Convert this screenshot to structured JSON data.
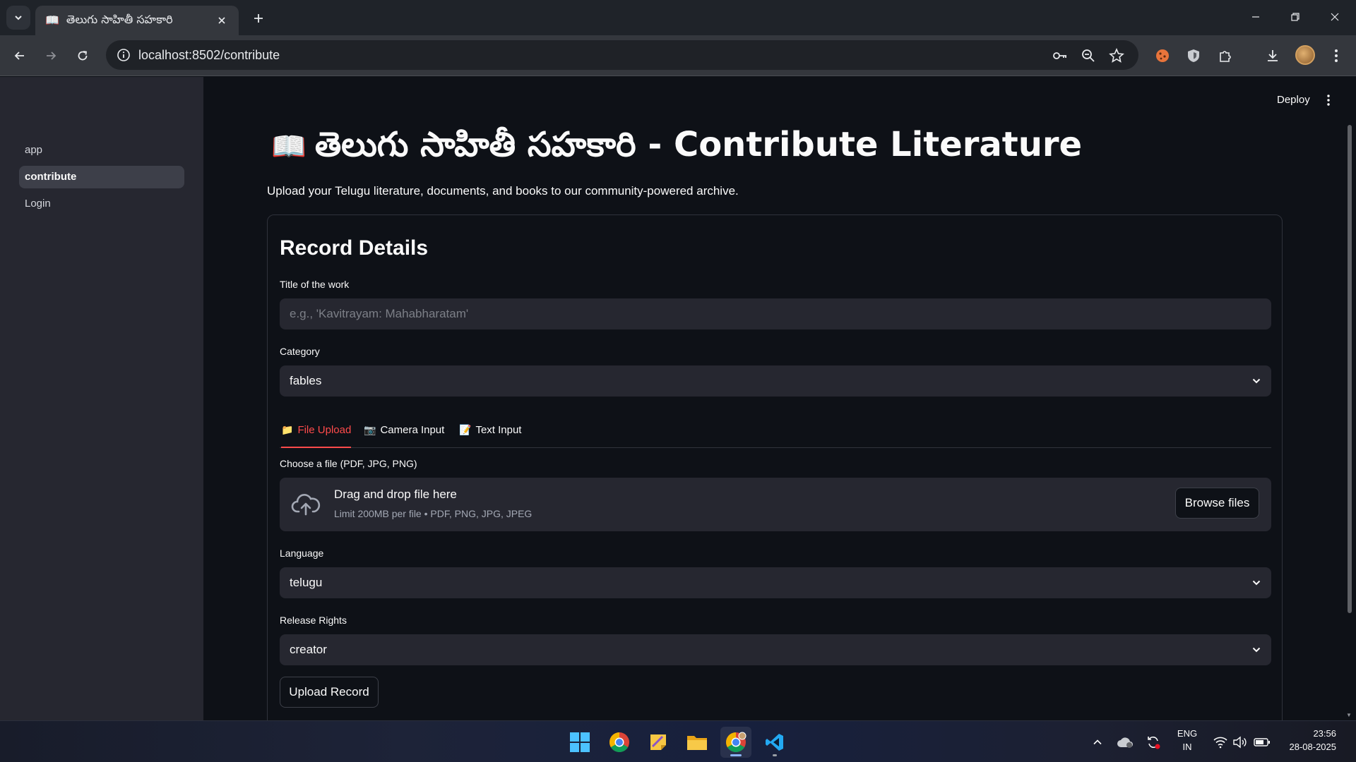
{
  "browser": {
    "tab": {
      "favicon": "📖",
      "title": "తెలుగు సాహితీ సహకారి"
    },
    "url": "localhost:8502/contribute"
  },
  "sidebar": {
    "items": [
      {
        "label": "app"
      },
      {
        "label": "contribute",
        "active": true
      },
      {
        "label": "Login"
      }
    ]
  },
  "header": {
    "deploy_label": "Deploy"
  },
  "page": {
    "title_icon": "📖",
    "title": "తెలుగు సాహితీ సహకారి - Contribute Literature",
    "subtitle": "Upload your Telugu literature, documents, and books to our community-powered archive."
  },
  "form": {
    "heading": "Record Details",
    "title_label": "Title of the work",
    "title_placeholder": "e.g., 'Kavitrayam: Mahabharatam'",
    "category_label": "Category",
    "category_value": "fables",
    "tabs": [
      {
        "icon": "📁",
        "label": "File Upload",
        "active": true
      },
      {
        "icon": "📷",
        "label": "Camera Input"
      },
      {
        "icon": "📝",
        "label": "Text Input"
      }
    ],
    "file_label": "Choose a file (PDF, JPG, PNG)",
    "dropzone_text": "Drag and drop file here",
    "dropzone_limit": "Limit 200MB per file • PDF, PNG, JPG, JPEG",
    "browse_label": "Browse files",
    "language_label": "Language",
    "language_value": "telugu",
    "rights_label": "Release Rights",
    "rights_value": "creator",
    "upload_label": "Upload Record"
  },
  "taskbar": {
    "lang_top": "ENG",
    "lang_bottom": "IN",
    "time": "23:56",
    "date": "28-08-2025"
  },
  "colors": {
    "accent": "#ff4b4b",
    "background": "#0e1117",
    "sidebar": "#262730"
  }
}
